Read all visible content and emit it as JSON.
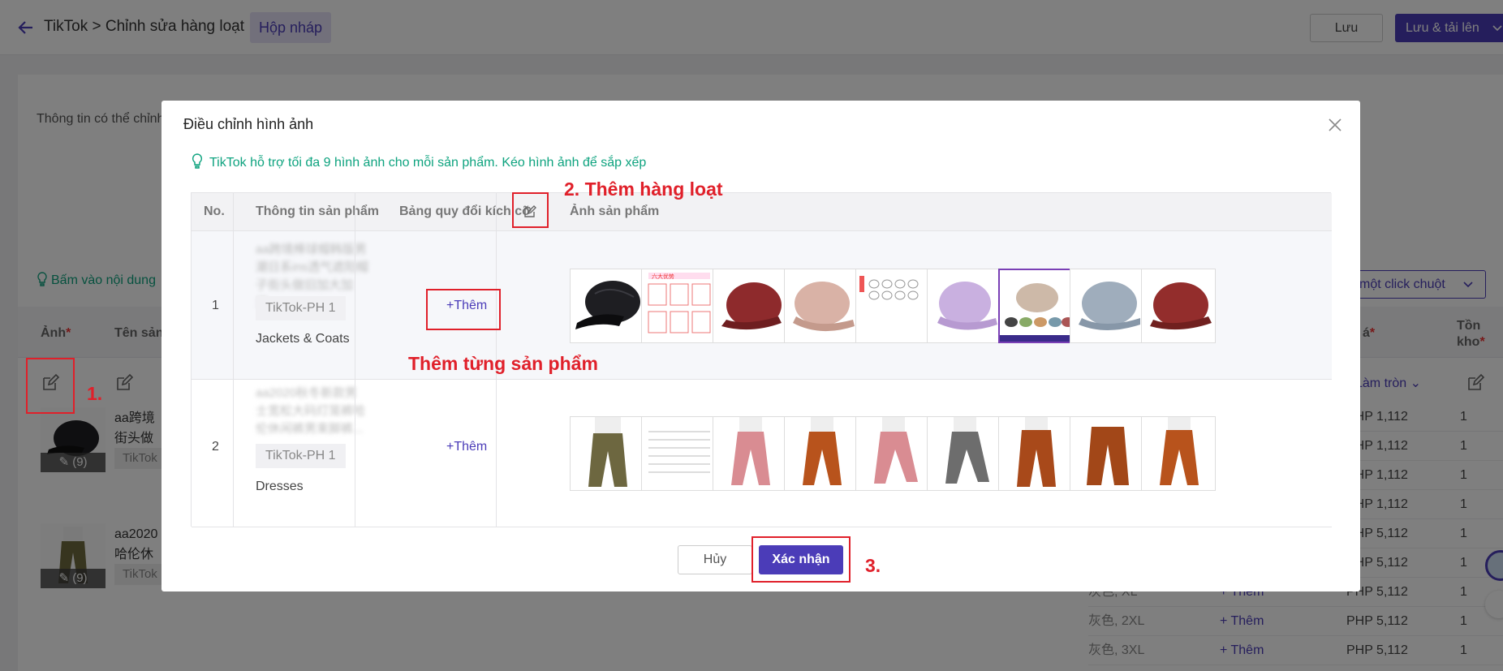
{
  "header": {
    "breadcrumb": "TikTok > Chỉnh sửa hàng loạt",
    "draft_tag": "Hộp nháp",
    "save_label": "Lưu",
    "save_upload_label": "Lưu & tải lên"
  },
  "background": {
    "info_text": "Thông tin có thể chỉnh",
    "hint_text": "Bấm vào nội dung",
    "batch_click_label": "một click chuột",
    "columns": {
      "image": "Ảnh",
      "name": "Tên sản",
      "price": "á",
      "stock": "Tồn kho"
    },
    "round_label": "Làm tròn",
    "products": [
      {
        "name": "aa跨境",
        "name2": "街头做旧",
        "shop": "TikTok",
        "count": "(9)"
      },
      {
        "name": "aa2020",
        "name2": "哈伦休闲",
        "shop": "TikTok",
        "count": "(9)"
      }
    ],
    "variant_rows": [
      {
        "variant": "",
        "add": "",
        "price": "PHP 1,112",
        "stock": "1"
      },
      {
        "variant": "",
        "add": "",
        "price": "PHP 1,112",
        "stock": "1"
      },
      {
        "variant": "",
        "add": "",
        "price": "PHP 1,112",
        "stock": "1"
      },
      {
        "variant": "",
        "add": "",
        "price": "PHP 1,112",
        "stock": "1"
      },
      {
        "variant": "",
        "add": "",
        "price": "PHP 5,112",
        "stock": "1"
      },
      {
        "variant": "",
        "add": "",
        "price": "PHP 5,112",
        "stock": "1"
      },
      {
        "variant": "灰色, XL",
        "add": "+ Thêm",
        "price": "PHP 5,112",
        "stock": "1"
      },
      {
        "variant": "灰色, 2XL",
        "add": "+ Thêm",
        "price": "PHP 5,112",
        "stock": "1"
      },
      {
        "variant": "灰色, 3XL",
        "add": "+ Thêm",
        "price": "PHP 5,112",
        "stock": "1"
      }
    ]
  },
  "modal": {
    "title": "Điều chỉnh hình ảnh",
    "tip": "TikTok hỗ trợ tối đa 9 hình ảnh cho mỗi sản phẩm. Kéo hình ảnh để sắp xếp",
    "columns": {
      "no": "No.",
      "info": "Thông tin sản phẩm",
      "size_chart": "Bảng quy đổi kích cỡ",
      "images": "Ảnh sản phẩm"
    },
    "rows": [
      {
        "no": "1",
        "name": "aa跨境棒球帽韩版男潮日系ins透气遮阳帽子街头做旧加大加深...",
        "shop": "TikTok-PH 1",
        "category": "Jackets & Coats",
        "add_label": "+Thêm",
        "images": [
          "black-cap",
          "promo-grid",
          "red-cap",
          "pink-cap",
          "size-sheet",
          "purple-cap",
          "cap-collection",
          "grey-cap",
          "red-cap"
        ]
      },
      {
        "no": "2",
        "name": "aa2020秋冬新款男士宽松大码灯笼裤哈伦休闲裤男束脚裤...",
        "shop": "TikTok-PH 1",
        "category": "Dresses",
        "add_label": "+Thêm",
        "images": [
          "olive-pants",
          "size-table",
          "pink-pants",
          "orange-pants",
          "pink-pants",
          "grey-pants",
          "rust-pants",
          "rust-pants",
          "orange-pants"
        ]
      }
    ],
    "cancel_label": "Hủy",
    "confirm_label": "Xác nhận"
  },
  "annotations": {
    "step1": "1.",
    "step2": "2. Thêm hàng loạt",
    "single_add": "Thêm từng sản phẩm",
    "step3": "3."
  },
  "colors": {
    "accent": "#4b3cb8",
    "tip_green": "#0ea37f",
    "annotation_red": "#e0202a"
  }
}
